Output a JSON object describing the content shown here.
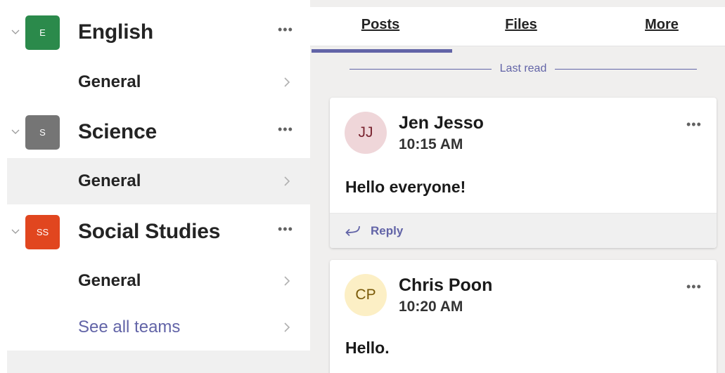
{
  "sidebar": {
    "teams": [
      {
        "name": "English",
        "initials": "E",
        "color": "#2b8a4b",
        "more": "•••",
        "channel": "General"
      },
      {
        "name": "Science",
        "initials": "S",
        "color": "#757575",
        "more": "•••",
        "channel": "General"
      },
      {
        "name": "Social Studies",
        "initials": "SS",
        "color": "#e1461f",
        "more": "•••",
        "channel": "General"
      }
    ],
    "see_all": "See all teams",
    "selected_team_index": 1
  },
  "tabs": [
    {
      "label": "Posts",
      "active": true
    },
    {
      "label": "Files",
      "active": false
    },
    {
      "label": "More",
      "active": false
    }
  ],
  "last_read": "Last read",
  "posts": [
    {
      "initials": "JJ",
      "avatar_bg": "#efd6d9",
      "avatar_fg": "#7a2531",
      "author": "Jen Jesso",
      "time": "10:15 AM",
      "body": "Hello everyone!",
      "reply": "Reply",
      "more": "•••"
    },
    {
      "initials": "CP",
      "avatar_bg": "#fcefc5",
      "avatar_fg": "#7a5a08",
      "author": "Chris Poon",
      "time": "10:20 AM",
      "body": "Hello.",
      "more": "•••"
    }
  ],
  "colors": {
    "accent": "#6264a7"
  }
}
